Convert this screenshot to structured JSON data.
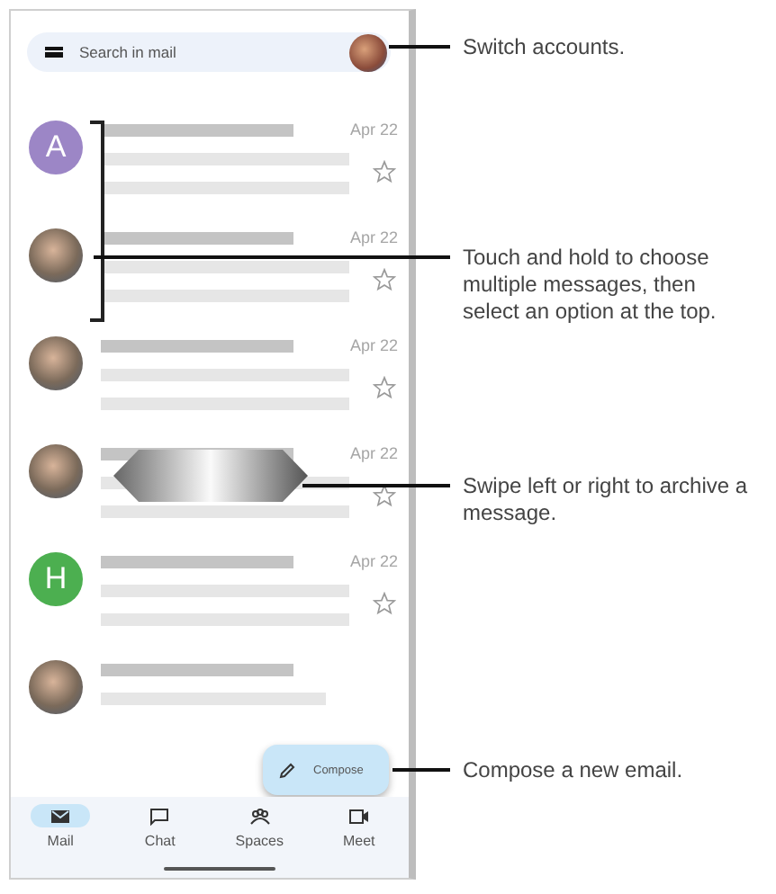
{
  "search": {
    "placeholder": "Search in mail"
  },
  "messages": [
    {
      "avatar": {
        "kind": "letter",
        "letter": "A",
        "color": "#9c86c6"
      },
      "date": "Apr 22",
      "starred": false
    },
    {
      "avatar": {
        "kind": "photo"
      },
      "date": "Apr 22",
      "starred": false
    },
    {
      "avatar": {
        "kind": "photo"
      },
      "date": "Apr 22",
      "starred": false
    },
    {
      "avatar": {
        "kind": "photo"
      },
      "date": "Apr 22",
      "starred": false
    },
    {
      "avatar": {
        "kind": "letter",
        "letter": "H",
        "color": "#4caf50"
      },
      "date": "Apr 22",
      "starred": false
    },
    {
      "avatar": {
        "kind": "photo"
      }
    }
  ],
  "compose": {
    "label": "Compose"
  },
  "nav": [
    {
      "kind": "mail",
      "label": "Mail",
      "selected": true
    },
    {
      "kind": "chat",
      "label": "Chat",
      "selected": false
    },
    {
      "kind": "spaces",
      "label": "Spaces",
      "selected": false
    },
    {
      "kind": "meet",
      "label": "Meet",
      "selected": false
    }
  ],
  "callouts": [
    {
      "text": "Switch accounts."
    },
    {
      "text": "Touch and hold to choose multiple messages, then select an option at the top."
    },
    {
      "text": "Swipe left or right to archive a message."
    },
    {
      "text": "Compose a new email."
    }
  ]
}
